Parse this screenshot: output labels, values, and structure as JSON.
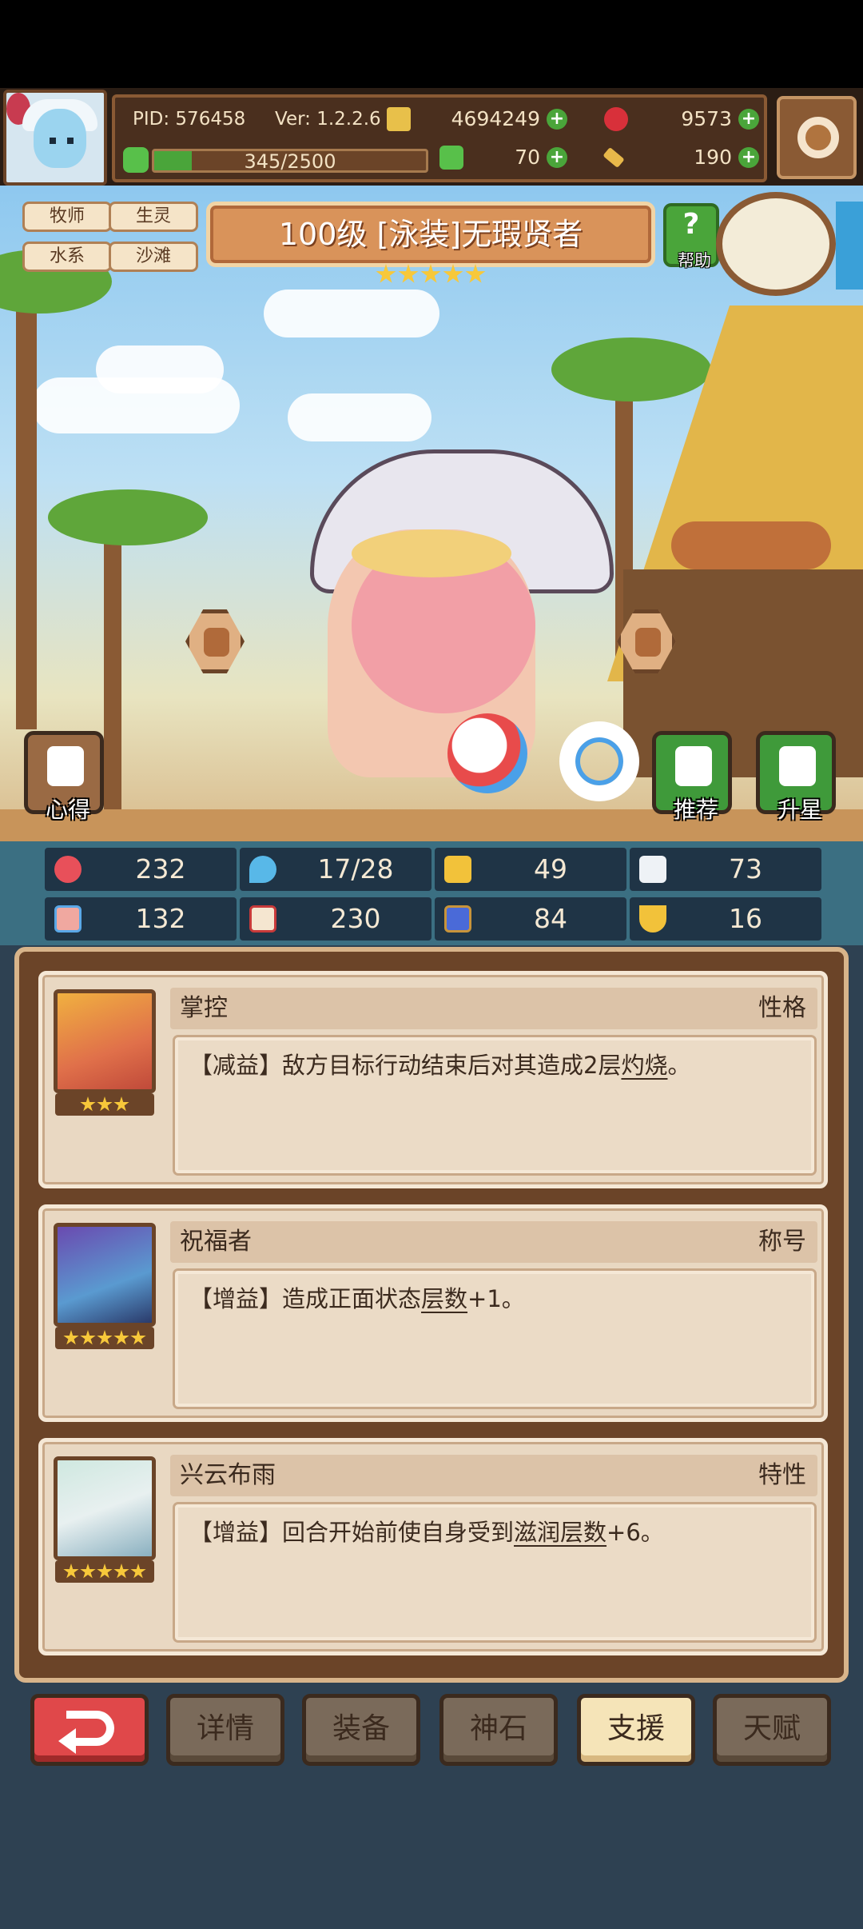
{
  "header": {
    "pid": "PID: 576458",
    "version": "Ver: 1.2.2.6",
    "xp": "345/2500",
    "xp_progress": 0.138,
    "resources": [
      {
        "name": "gold",
        "icon": "coin-icon",
        "value": "4694249"
      },
      {
        "name": "ruby",
        "icon": "ruby-icon",
        "value": "9573"
      },
      {
        "name": "clover",
        "icon": "clover-icon",
        "value": "70"
      },
      {
        "name": "key",
        "icon": "key-icon",
        "value": "190"
      }
    ]
  },
  "hero": {
    "tags": [
      "牧师",
      "生灵",
      "水系",
      "沙滩"
    ],
    "title": "100级 [泳装]无瑕贤者",
    "stars": 5,
    "help_label": "帮助",
    "left_button_label": "心得",
    "recommend_label": "推荐",
    "upgrade_label": "升星"
  },
  "stats": [
    {
      "icon": "heart-icon",
      "value": "232"
    },
    {
      "icon": "water-drop-icon",
      "value": "17/28"
    },
    {
      "icon": "shield-icon",
      "value": "49"
    },
    {
      "icon": "wing-icon",
      "value": "73"
    },
    {
      "icon": "fist-icon",
      "value": "132"
    },
    {
      "icon": "book-icon",
      "value": "230"
    },
    {
      "icon": "boot-icon",
      "value": "84"
    },
    {
      "icon": "horseshoe-icon",
      "value": "16"
    }
  ],
  "supports": [
    {
      "name": "掌控",
      "type": "性格",
      "stars": 3,
      "desc_prefix": "【减益】敌方目标行动结束后对其造成2层",
      "desc_link": "灼烧",
      "desc_suffix": "。"
    },
    {
      "name": "祝福者",
      "type": "称号",
      "stars": 5,
      "desc_prefix": "【增益】造成正面状态",
      "desc_link": "层数",
      "desc_suffix": "+1。"
    },
    {
      "name": "兴云布雨",
      "type": "特性",
      "stars": 5,
      "desc_prefix": "【增益】回合开始前使自身受到",
      "desc_link": "滋润层数",
      "desc_suffix": "+6。"
    }
  ],
  "nav": {
    "back": "back-arrow-icon",
    "tabs": [
      "详情",
      "装备",
      "神石",
      "支援",
      "天赋"
    ],
    "active": "支援"
  },
  "colors": {
    "accent_green": "#4aa53a",
    "panel_brown": "#6b4428",
    "card_beige": "#e9d8c2",
    "nav_active": "#f5e4b8",
    "back_red": "#e0484a"
  }
}
